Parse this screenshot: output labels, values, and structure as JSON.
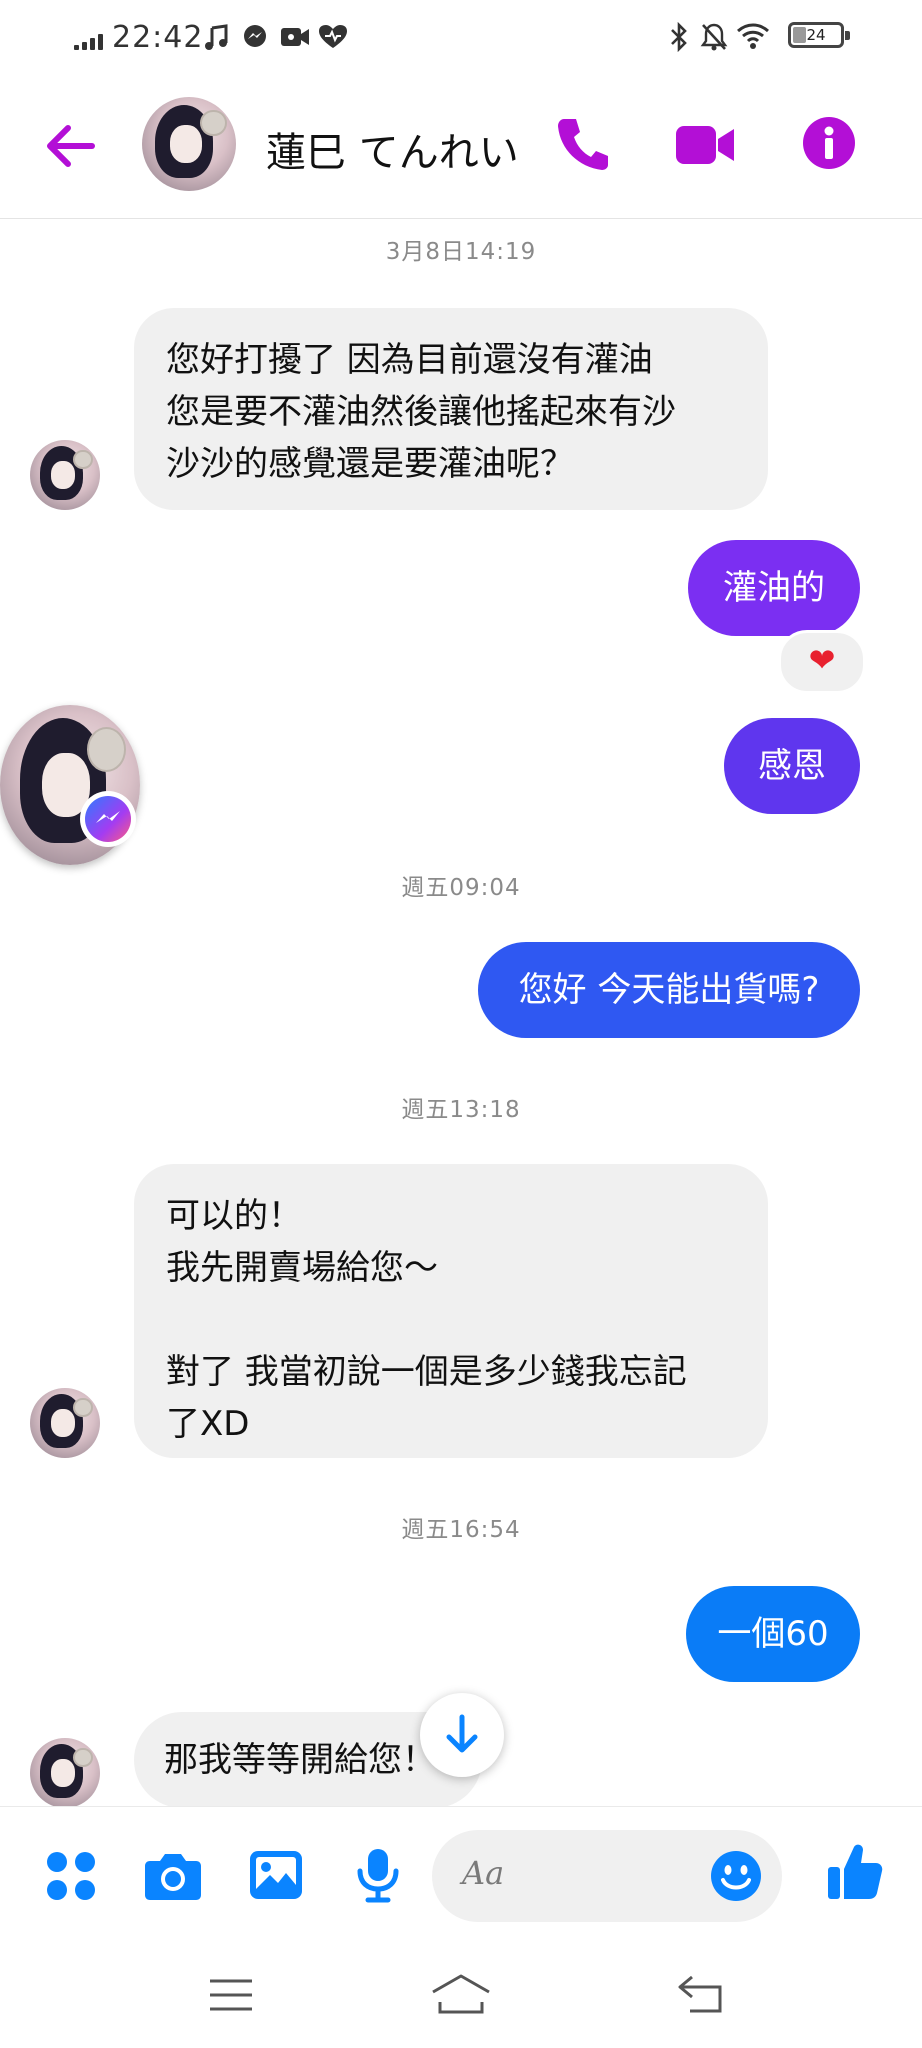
{
  "status_bar": {
    "time": "22:42",
    "battery": "24"
  },
  "header": {
    "contact_name": "蓮巳 てんれい"
  },
  "messages": [
    {
      "type": "timestamp",
      "text": "3月8日14:19"
    },
    {
      "type": "incoming",
      "text": "您好打擾了 因為目前還沒有灌油\n您是要不灌油然後讓他搖起來有沙\n沙沙的感覺還是要灌油呢？"
    },
    {
      "type": "outgoing",
      "text": "灌油的",
      "reaction": "❤"
    },
    {
      "type": "outgoing",
      "text": "感恩"
    },
    {
      "type": "timestamp",
      "text": "週五09:04"
    },
    {
      "type": "outgoing",
      "text": "您好 今天能出貨嗎?"
    },
    {
      "type": "timestamp",
      "text": "週五13:18"
    },
    {
      "type": "incoming",
      "text": "可以的！\n我先開賣場給您～\n\n對了 我當初說一個是多少錢我忘記\n了XD"
    },
    {
      "type": "timestamp",
      "text": "週五16:54"
    },
    {
      "type": "outgoing",
      "text": "一個60"
    },
    {
      "type": "incoming",
      "text": "那我等等開給您！"
    }
  ],
  "composer": {
    "placeholder": "Aa"
  },
  "colors": {
    "accent_purple": "#b30fd6",
    "bubble_violet": "#7b2ff2",
    "bubble_indigo": "#5f36ee",
    "bubble_blue": "#2f58f2",
    "bubble_azure": "#0a7cf7",
    "messenger_blue": "#0a84ff"
  }
}
